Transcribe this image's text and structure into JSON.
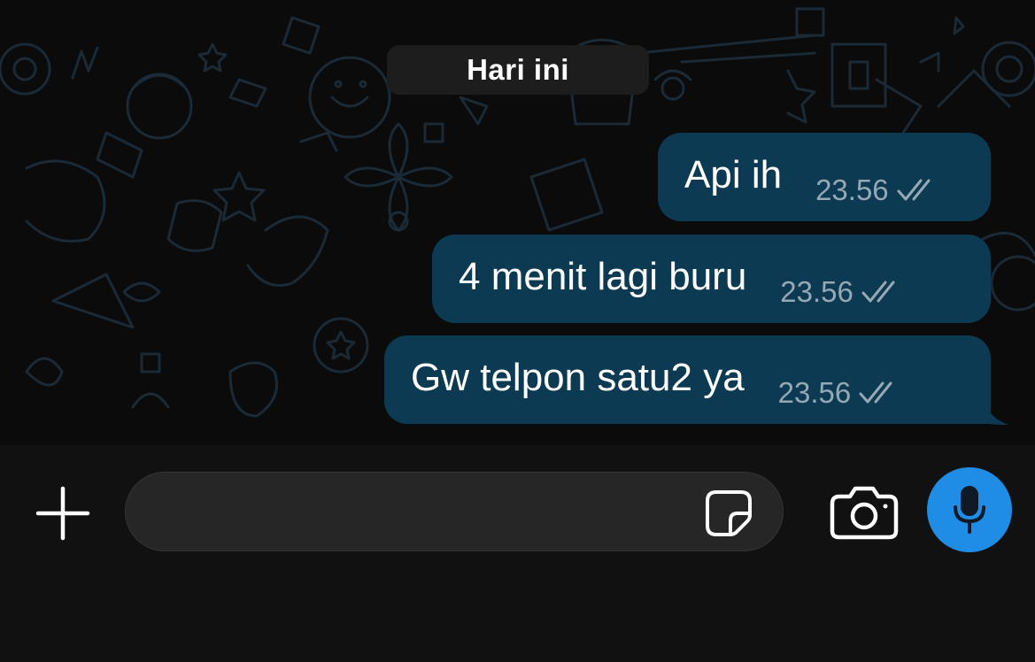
{
  "chat": {
    "date_separator": "Hari ini",
    "messages": [
      {
        "text": "Api ih",
        "time": "23.56",
        "status": "read-double-check"
      },
      {
        "text": "4 menit lagi buru",
        "time": "23.56",
        "status": "read-double-check"
      },
      {
        "text": "Gw telpon satu2 ya",
        "time": "23.56",
        "status": "read-double-check"
      }
    ]
  },
  "composer": {
    "placeholder": "",
    "value": "",
    "icons": {
      "add": "plus-icon",
      "sticker": "sticker-icon",
      "camera": "camera-icon",
      "voice": "microphone-icon"
    }
  },
  "colors": {
    "chat_background": "#0b0b0b",
    "outgoing_bubble": "#0c3a52",
    "timestamp": "#96a8b4",
    "date_chip": "#1d1d1d",
    "input_bar": "#111111",
    "input_field": "#262626",
    "accent_mic": "#1f8ce6"
  }
}
